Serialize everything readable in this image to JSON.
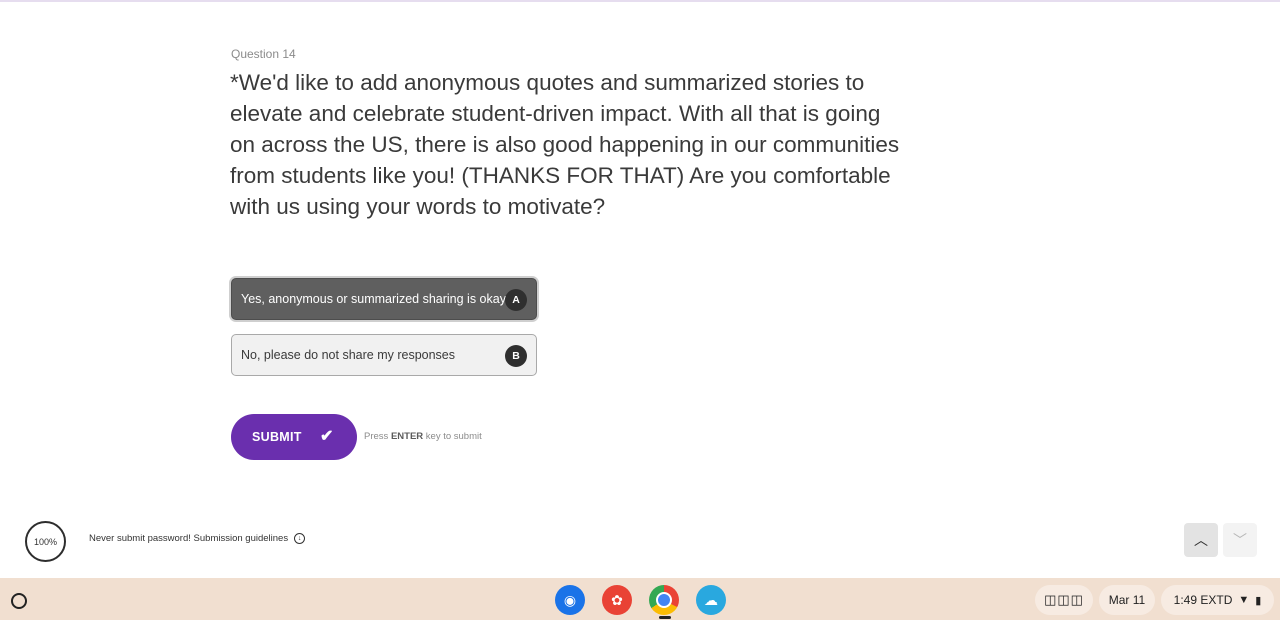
{
  "question": {
    "number_label": "Question 14",
    "text": "*We'd like to add anonymous quotes and summarized stories to elevate and celebrate student-driven impact. With all that is going on across the US, there is also good happening in our communities from students like you! (THANKS FOR THAT) Are you comfortable with us using your words to motivate?"
  },
  "choices": [
    {
      "label": "Yes, anonymous or summarized sharing is okay",
      "key": "A",
      "selected": true
    },
    {
      "label": "No, please do not share my responses",
      "key": "B",
      "selected": false
    }
  ],
  "submit": {
    "label": "SUBMIT",
    "hint_prefix": "Press ",
    "hint_key": "ENTER",
    "hint_suffix": " key to submit"
  },
  "footer": {
    "progress": "100%",
    "note": "Never submit password! Submission guidelines"
  },
  "shelf": {
    "apps": [
      "camera-icon",
      "paint-icon",
      "chrome-icon",
      "files-icon"
    ],
    "phone_hub": "◫◫◫",
    "date": "Mar 11",
    "time": "1:49 EXTD"
  },
  "colors": {
    "accent": "#6a2fae",
    "selected_choice": "#5f5f5f",
    "shelf": "#f1dfd0"
  }
}
